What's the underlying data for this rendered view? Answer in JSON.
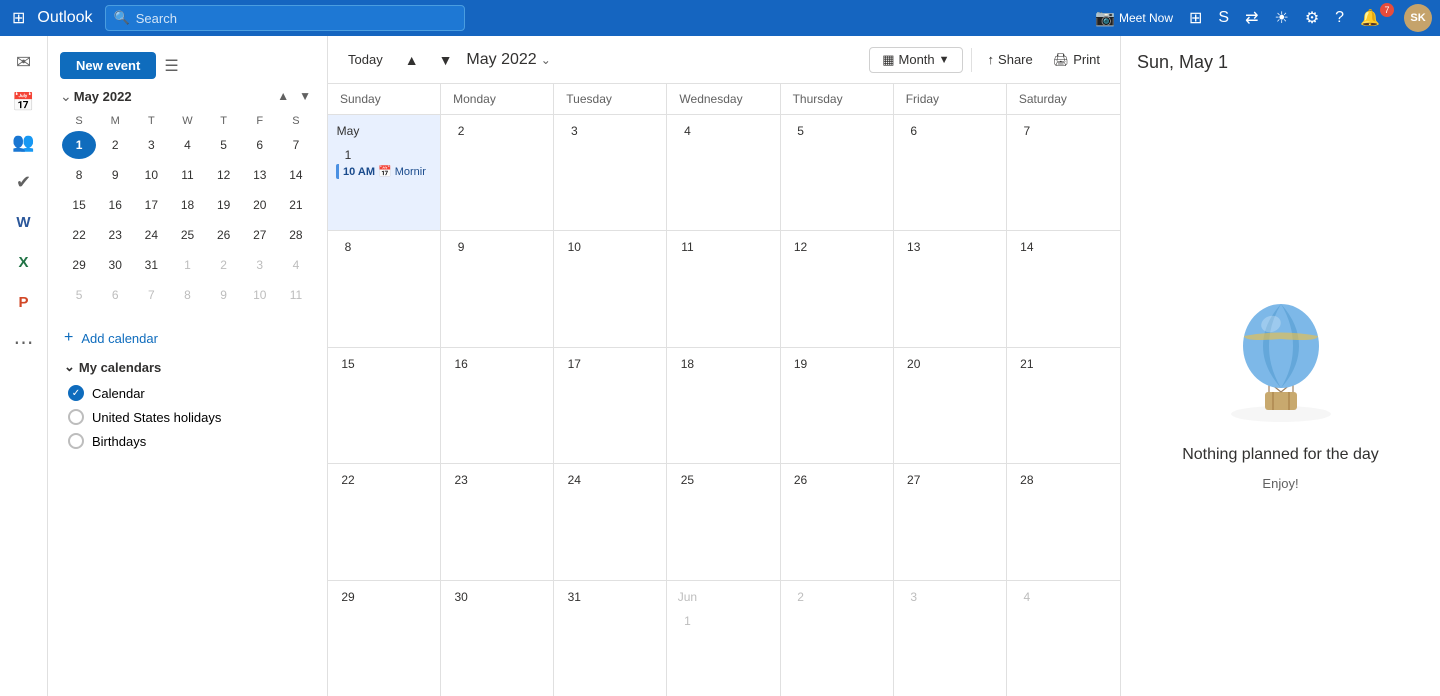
{
  "app": {
    "name": "Outlook"
  },
  "topbar": {
    "search_placeholder": "Search",
    "meet_now_label": "Meet Now",
    "avatar_initials": "SK",
    "notification_count": "7"
  },
  "toolbar": {
    "new_event_label": "New event",
    "today_label": "Today",
    "current_month": "May 2022",
    "view_label": "Month",
    "share_label": "Share",
    "print_label": "Print"
  },
  "mini_calendar": {
    "title": "May 2022",
    "day_headers": [
      "S",
      "M",
      "T",
      "W",
      "T",
      "F",
      "S"
    ],
    "weeks": [
      [
        {
          "day": 1,
          "current": true,
          "today": true
        },
        {
          "day": 2
        },
        {
          "day": 3
        },
        {
          "day": 4
        },
        {
          "day": 5
        },
        {
          "day": 6
        },
        {
          "day": 7
        }
      ],
      [
        {
          "day": 8
        },
        {
          "day": 9
        },
        {
          "day": 10
        },
        {
          "day": 11
        },
        {
          "day": 12
        },
        {
          "day": 13
        },
        {
          "day": 14
        }
      ],
      [
        {
          "day": 15
        },
        {
          "day": 16
        },
        {
          "day": 17
        },
        {
          "day": 18
        },
        {
          "day": 19
        },
        {
          "day": 20
        },
        {
          "day": 21
        }
      ],
      [
        {
          "day": 22
        },
        {
          "day": 23
        },
        {
          "day": 24
        },
        {
          "day": 25
        },
        {
          "day": 26
        },
        {
          "day": 27
        },
        {
          "day": 28
        }
      ],
      [
        {
          "day": 29
        },
        {
          "day": 30
        },
        {
          "day": 31
        },
        {
          "day": 1,
          "other": true
        },
        {
          "day": 2,
          "other": true
        },
        {
          "day": 3,
          "other": true
        },
        {
          "day": 4,
          "other": true
        }
      ],
      [
        {
          "day": 5,
          "other": true
        },
        {
          "day": 6,
          "other": true
        },
        {
          "day": 7,
          "other": true
        },
        {
          "day": 8,
          "other": true
        },
        {
          "day": 9,
          "other": true
        },
        {
          "day": 10,
          "other": true
        },
        {
          "day": 11,
          "other": true
        }
      ]
    ]
  },
  "add_calendar_label": "Add calendar",
  "my_calendars_label": "My calendars",
  "calendars": [
    {
      "name": "Calendar",
      "checked": true
    },
    {
      "name": "United States holidays",
      "checked": false
    },
    {
      "name": "Birthdays",
      "checked": false
    }
  ],
  "cal_headers": [
    "Sunday",
    "Monday",
    "Tuesday",
    "Wednesday",
    "Thursday",
    "Friday",
    "Saturday"
  ],
  "cal_weeks": [
    {
      "cells": [
        {
          "day": "May 1",
          "selected": true,
          "events": [
            {
              "time": "10 AM",
              "title": "Mornir",
              "icon": "📅"
            }
          ]
        },
        {
          "day": "2",
          "events": []
        },
        {
          "day": "3",
          "events": []
        },
        {
          "day": "4",
          "events": []
        },
        {
          "day": "5",
          "events": []
        },
        {
          "day": "6",
          "events": []
        },
        {
          "day": "7",
          "events": []
        }
      ]
    },
    {
      "cells": [
        {
          "day": "8",
          "events": []
        },
        {
          "day": "9",
          "events": []
        },
        {
          "day": "10",
          "events": []
        },
        {
          "day": "11",
          "events": []
        },
        {
          "day": "12",
          "events": []
        },
        {
          "day": "13",
          "events": []
        },
        {
          "day": "14",
          "events": []
        }
      ]
    },
    {
      "cells": [
        {
          "day": "15",
          "events": []
        },
        {
          "day": "16",
          "events": []
        },
        {
          "day": "17",
          "events": []
        },
        {
          "day": "18",
          "events": []
        },
        {
          "day": "19",
          "events": []
        },
        {
          "day": "20",
          "events": []
        },
        {
          "day": "21",
          "events": []
        }
      ]
    },
    {
      "cells": [
        {
          "day": "22",
          "events": []
        },
        {
          "day": "23",
          "events": []
        },
        {
          "day": "24",
          "events": []
        },
        {
          "day": "25",
          "events": []
        },
        {
          "day": "26",
          "events": []
        },
        {
          "day": "27",
          "events": []
        },
        {
          "day": "28",
          "events": []
        }
      ]
    },
    {
      "cells": [
        {
          "day": "29",
          "events": []
        },
        {
          "day": "30",
          "events": []
        },
        {
          "day": "31",
          "events": []
        },
        {
          "day": "Jun 1",
          "other": true,
          "events": []
        },
        {
          "day": "2",
          "other": true,
          "events": []
        },
        {
          "day": "3",
          "other": true,
          "events": []
        },
        {
          "day": "4",
          "other": true,
          "events": []
        }
      ]
    }
  ],
  "right_panel": {
    "title": "Sun, May 1",
    "nothing_planned": "Nothing planned for the day",
    "enjoy": "Enjoy!"
  },
  "nav_icons": [
    {
      "name": "mail-icon",
      "symbol": "✉",
      "label": "Mail",
      "active": false
    },
    {
      "name": "calendar-icon",
      "symbol": "📅",
      "label": "Calendar",
      "active": true
    },
    {
      "name": "people-icon",
      "symbol": "👥",
      "label": "People",
      "active": false
    },
    {
      "name": "tasks-icon",
      "symbol": "✔",
      "label": "Tasks",
      "active": false
    },
    {
      "name": "word-icon",
      "symbol": "W",
      "label": "Word",
      "active": false
    },
    {
      "name": "excel-icon",
      "symbol": "X",
      "label": "Excel",
      "active": false
    },
    {
      "name": "powerpoint-icon",
      "symbol": "P",
      "label": "PowerPoint",
      "active": false
    },
    {
      "name": "more-apps-icon",
      "symbol": "⋯",
      "label": "More apps",
      "active": false
    }
  ]
}
